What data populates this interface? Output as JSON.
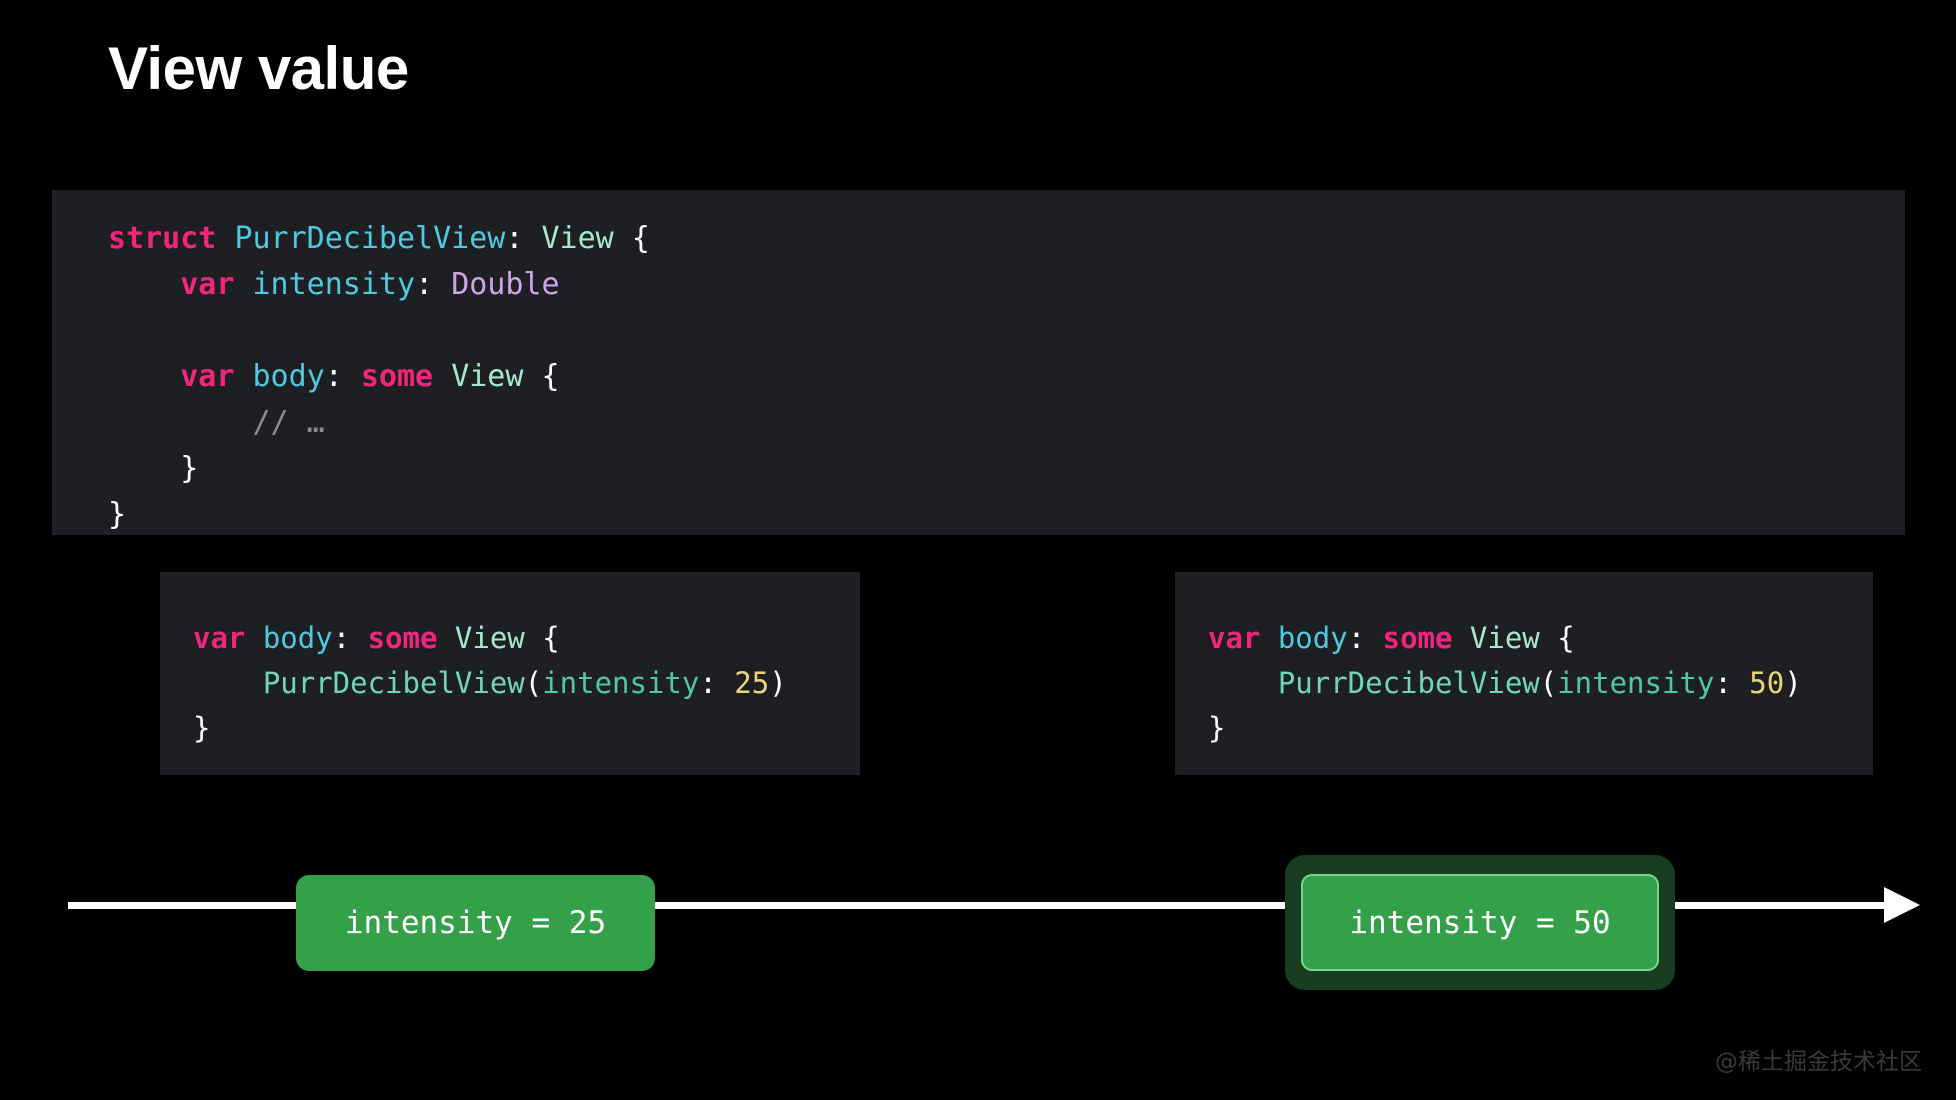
{
  "slide": {
    "title": "View value",
    "background_color": "#000000"
  },
  "theme": {
    "code_background": "#1e1f23",
    "keyword_color": "#f2257e",
    "type_color": "#4ec9e0",
    "protocol_color": "#a5e8cd",
    "value_type_color": "#cba6e8",
    "comment_color": "#8b8b92",
    "call_color": "#6fd7b5",
    "label_color": "#4ec9a0",
    "number_color": "#e8d47a",
    "pill_green": "#34a14a",
    "pill_highlight_green": "#173f1f",
    "timeline_color": "#ffffff"
  },
  "code_main": {
    "lines": [
      [
        {
          "t": "struct ",
          "c": "tok-kw"
        },
        {
          "t": "PurrDecibelView",
          "c": "tok-type"
        },
        {
          "t": ": ",
          "c": "tok-punct"
        },
        {
          "t": "View",
          "c": "tok-proto"
        },
        {
          "t": " {",
          "c": "tok-punct"
        }
      ],
      [
        {
          "t": "    ",
          "c": "tok-punct"
        },
        {
          "t": "var ",
          "c": "tok-kw"
        },
        {
          "t": "intensity",
          "c": "tok-prop"
        },
        {
          "t": ": ",
          "c": "tok-punct"
        },
        {
          "t": "Double",
          "c": "tok-valtype"
        }
      ],
      [],
      [
        {
          "t": "    ",
          "c": "tok-punct"
        },
        {
          "t": "var ",
          "c": "tok-kw"
        },
        {
          "t": "body",
          "c": "tok-prop"
        },
        {
          "t": ": ",
          "c": "tok-punct"
        },
        {
          "t": "some ",
          "c": "tok-kw"
        },
        {
          "t": "View",
          "c": "tok-proto"
        },
        {
          "t": " {",
          "c": "tok-punct"
        }
      ],
      [
        {
          "t": "        ",
          "c": "tok-punct"
        },
        {
          "t": "// …",
          "c": "tok-comment"
        }
      ],
      [
        {
          "t": "    }",
          "c": "tok-punct"
        }
      ],
      [
        {
          "t": "}",
          "c": "tok-punct"
        }
      ]
    ]
  },
  "code_left": {
    "lines": [
      [
        {
          "t": "var ",
          "c": "tok-kw"
        },
        {
          "t": "body",
          "c": "tok-prop"
        },
        {
          "t": ": ",
          "c": "tok-punct"
        },
        {
          "t": "some ",
          "c": "tok-kw"
        },
        {
          "t": "View",
          "c": "tok-proto"
        },
        {
          "t": " {",
          "c": "tok-punct"
        }
      ],
      [
        {
          "t": "    ",
          "c": "tok-punct"
        },
        {
          "t": "PurrDecibelView",
          "c": "tok-call"
        },
        {
          "t": "(",
          "c": "tok-punct"
        },
        {
          "t": "intensity",
          "c": "tok-label"
        },
        {
          "t": ": ",
          "c": "tok-punct"
        },
        {
          "t": "25",
          "c": "tok-num"
        },
        {
          "t": ")",
          "c": "tok-punct"
        }
      ],
      [
        {
          "t": "}",
          "c": "tok-punct"
        }
      ]
    ]
  },
  "code_right": {
    "lines": [
      [
        {
          "t": "var ",
          "c": "tok-kw"
        },
        {
          "t": "body",
          "c": "tok-prop"
        },
        {
          "t": ": ",
          "c": "tok-punct"
        },
        {
          "t": "some ",
          "c": "tok-kw"
        },
        {
          "t": "View",
          "c": "tok-proto"
        },
        {
          "t": " {",
          "c": "tok-punct"
        }
      ],
      [
        {
          "t": "    ",
          "c": "tok-punct"
        },
        {
          "t": "PurrDecibelView",
          "c": "tok-call"
        },
        {
          "t": "(",
          "c": "tok-punct"
        },
        {
          "t": "intensity",
          "c": "tok-label"
        },
        {
          "t": ": ",
          "c": "tok-punct"
        },
        {
          "t": "50",
          "c": "tok-num"
        },
        {
          "t": ")",
          "c": "tok-punct"
        }
      ],
      [
        {
          "t": "}",
          "c": "tok-punct"
        }
      ]
    ]
  },
  "timeline": {
    "pill_left_label": "intensity = 25",
    "pill_right_label": "intensity = 50",
    "pill_right_highlighted": true
  },
  "watermark": {
    "text": "@稀土掘金技术社区"
  }
}
